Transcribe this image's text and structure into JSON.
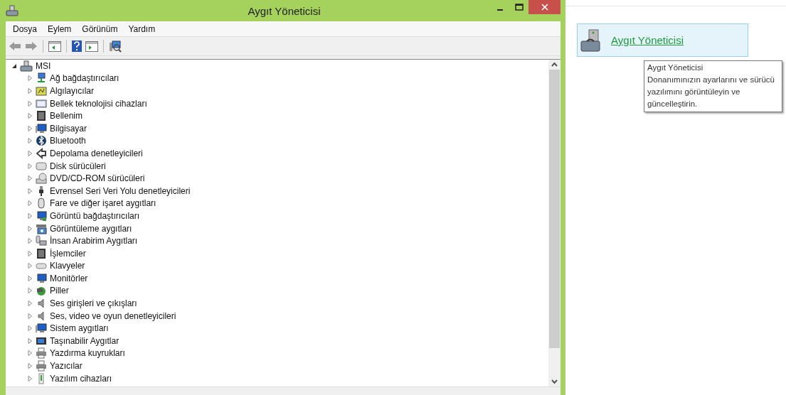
{
  "window": {
    "title": "Aygıt Yöneticisi"
  },
  "menu": [
    "Dosya",
    "Eylem",
    "Görünüm",
    "Yardım"
  ],
  "tree": {
    "label": "MSI",
    "expanded": true,
    "children": [
      {
        "label": "Ağ bağdaştırıcıları",
        "expanded": false
      },
      {
        "label": "Algılayıcılar",
        "expanded": false
      },
      {
        "label": "Bellek teknolojisi cihazları",
        "expanded": false
      },
      {
        "label": "Bellenim",
        "expanded": false
      },
      {
        "label": "Bilgisayar",
        "expanded": false
      },
      {
        "label": "Bluetooth",
        "expanded": false
      },
      {
        "label": "Depolama denetleyicileri",
        "expanded": false
      },
      {
        "label": "Disk sürücüleri",
        "expanded": false
      },
      {
        "label": "DVD/CD-ROM sürücüleri",
        "expanded": false
      },
      {
        "label": "Evrensel Seri Veri Yolu denetleyicileri",
        "expanded": false
      },
      {
        "label": "Fare ve diğer işaret aygıtları",
        "expanded": false
      },
      {
        "label": "Görüntü bağdaştırıcıları",
        "expanded": false
      },
      {
        "label": "Görüntüleme aygıtları",
        "expanded": false
      },
      {
        "label": "İnsan Arabirim Aygıtları",
        "expanded": false
      },
      {
        "label": "İşlemciler",
        "expanded": false
      },
      {
        "label": "Klavyeler",
        "expanded": false
      },
      {
        "label": "Monitörler",
        "expanded": false
      },
      {
        "label": "Piller",
        "expanded": false
      },
      {
        "label": "Ses girişleri ve çıkışları",
        "expanded": false
      },
      {
        "label": "Ses, video ve oyun denetleyicileri",
        "expanded": false
      },
      {
        "label": "Sistem aygıtları",
        "expanded": false
      },
      {
        "label": "Taşınabilir Aygıtlar",
        "expanded": false
      },
      {
        "label": "Yazdırma kuyrukları",
        "expanded": false
      },
      {
        "label": "Yazıcılar",
        "expanded": false
      },
      {
        "label": "Yazılım cihazları",
        "expanded": false
      }
    ]
  },
  "panel": {
    "link": "Aygıt Yöneticisi",
    "tooltip": {
      "title": "Aygıt Yöneticisi",
      "text": "Donanımınızın ayarlarını ve sürücü yazılımını görüntüleyin ve güncelleştirin."
    }
  }
}
